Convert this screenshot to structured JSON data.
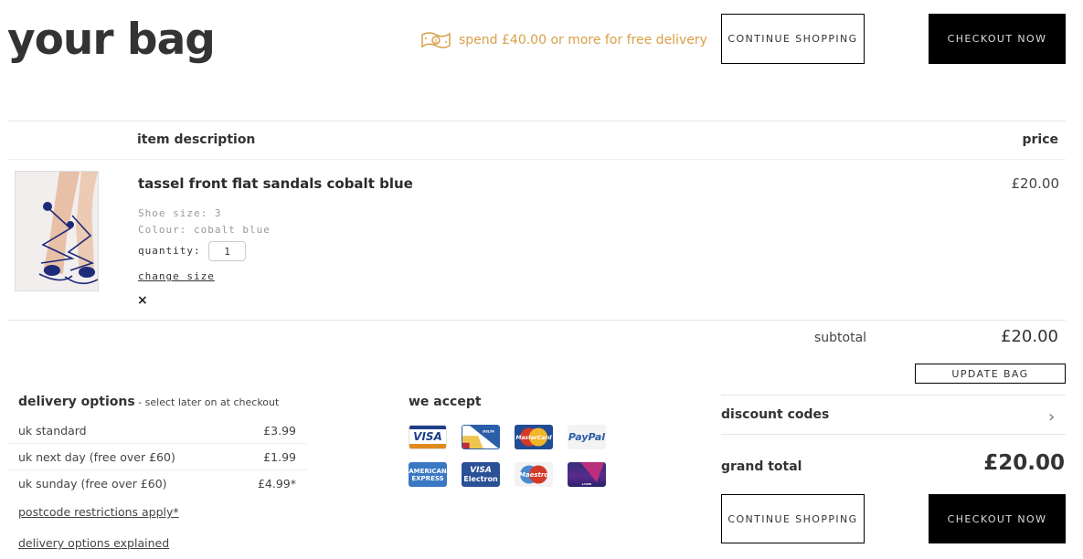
{
  "header": {
    "title": "your bag",
    "promo_text": "spend £40.00 or more for free delivery",
    "promo_icon": "banknote-icon",
    "continue_label": "CONTINUE SHOPPING",
    "checkout_label": "CHECKOUT NOW"
  },
  "table": {
    "col_description": "item description",
    "col_price": "price"
  },
  "item": {
    "name": "tassel front flat sandals cobalt blue",
    "price": "£20.00",
    "shoe_size": "Shoe size: 3",
    "colour": "Colour: cobalt blue",
    "quantity_label": "quantity:",
    "quantity": "1",
    "change_size": "change size",
    "remove": "×",
    "image_alt": "tassel front flat sandals cobalt blue"
  },
  "summary": {
    "subtotal_label": "subtotal",
    "subtotal_value": "£20.00",
    "update_bag": "UPDATE BAG",
    "discount_label": "discount codes",
    "grand_total_label": "grand total",
    "grand_total_value": "£20.00",
    "continue_label": "CONTINUE SHOPPING",
    "checkout_label": "CHECKOUT NOW"
  },
  "delivery": {
    "title": "delivery options",
    "subtitle": " - select later on at checkout",
    "options": [
      {
        "name": "uk standard",
        "price": "£3.99"
      },
      {
        "name": "uk next day (free over £60)",
        "price": "£1.99"
      },
      {
        "name": "uk sunday (free over £60)",
        "price": "£4.99*"
      }
    ],
    "postcode_link": "postcode restrictions apply*",
    "explained_link": "delivery options explained"
  },
  "payment": {
    "title": "we accept",
    "cards": [
      "VISA",
      "DELTA",
      "MasterCard",
      "PayPal",
      "AMERICAN EXPRESS",
      "VISA Electron",
      "Maestro",
      "LASER"
    ]
  },
  "colors": {
    "accent_promo": "#d9a04a",
    "button_dark": "#000000",
    "text": "#333333"
  }
}
